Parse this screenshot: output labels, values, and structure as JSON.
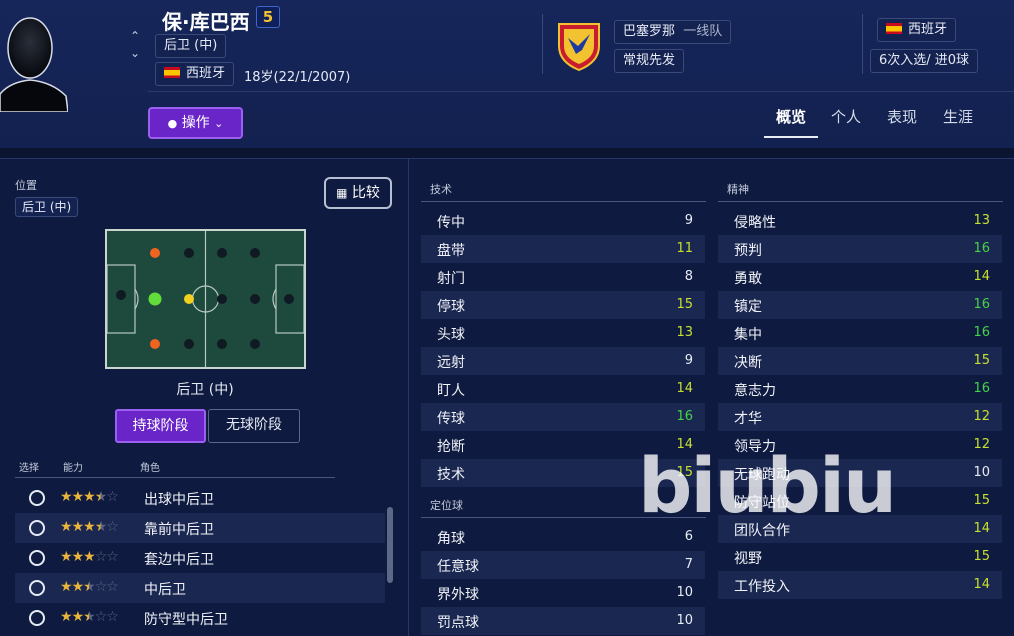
{
  "header": {
    "player_name": "保·库巴西",
    "shirt_number": "5",
    "position": "后卫 (中)",
    "nationality": "西班牙",
    "age": "18岁(22/1/2007)",
    "club": "巴塞罗那",
    "squad": "一线队",
    "role_status": "常规先发",
    "intl_nation": "西班牙",
    "intl_record": "6次入选/ 进0球",
    "action_label": "操作",
    "tabs": [
      "概览",
      "个人",
      "表现",
      "生涯"
    ],
    "active_tab": "概览"
  },
  "left": {
    "position_label": "位置",
    "position_value": "后卫 (中)",
    "compare_label": "比较",
    "pitch_caption": "后卫 (中)",
    "phase_in": "持球阶段",
    "phase_out": "无球阶段",
    "col_select": "选择",
    "col_ability": "能力",
    "col_role": "角色",
    "roles": [
      {
        "name": "出球中后卫",
        "stars": 3.5
      },
      {
        "name": "靠前中后卫",
        "stars": 3.5
      },
      {
        "name": "套边中后卫",
        "stars": 3
      },
      {
        "name": "中后卫",
        "stars": 2.5
      },
      {
        "name": "防守型中后卫",
        "stars": 2.5
      }
    ]
  },
  "technical": {
    "title": "技术",
    "items": [
      {
        "name": "传中",
        "value": "9",
        "color": "#e8ecf5"
      },
      {
        "name": "盘带",
        "value": "11",
        "color": "#c6e030"
      },
      {
        "name": "射门",
        "value": "8",
        "color": "#e8ecf5"
      },
      {
        "name": "停球",
        "value": "15",
        "color": "#c6e030"
      },
      {
        "name": "头球",
        "value": "13",
        "color": "#c6e030"
      },
      {
        "name": "远射",
        "value": "9",
        "color": "#e8ecf5"
      },
      {
        "name": "盯人",
        "value": "14",
        "color": "#c6e030"
      },
      {
        "name": "传球",
        "value": "16",
        "color": "#44d24a"
      },
      {
        "name": "抢断",
        "value": "14",
        "color": "#c6e030"
      },
      {
        "name": "技术",
        "value": "15",
        "color": "#c6e030"
      }
    ]
  },
  "set_pieces": {
    "title": "定位球",
    "items": [
      {
        "name": "角球",
        "value": "6",
        "color": "#e8ecf5"
      },
      {
        "name": "任意球",
        "value": "7",
        "color": "#e8ecf5"
      },
      {
        "name": "界外球",
        "value": "10",
        "color": "#e8ecf5"
      },
      {
        "name": "罚点球",
        "value": "10",
        "color": "#e8ecf5"
      }
    ]
  },
  "mental": {
    "title": "精神",
    "items": [
      {
        "name": "侵略性",
        "value": "13",
        "color": "#c6e030"
      },
      {
        "name": "预判",
        "value": "16",
        "color": "#44d24a"
      },
      {
        "name": "勇敢",
        "value": "14",
        "color": "#c6e030"
      },
      {
        "name": "镇定",
        "value": "16",
        "color": "#44d24a"
      },
      {
        "name": "集中",
        "value": "16",
        "color": "#44d24a"
      },
      {
        "name": "决断",
        "value": "15",
        "color": "#c6e030"
      },
      {
        "name": "意志力",
        "value": "16",
        "color": "#44d24a"
      },
      {
        "name": "才华",
        "value": "12",
        "color": "#c6e030"
      },
      {
        "name": "领导力",
        "value": "12",
        "color": "#c6e030"
      },
      {
        "name": "无球跑动",
        "value": "10",
        "color": "#e8ecf5"
      },
      {
        "name": "防守站位",
        "value": "15",
        "color": "#c6e030"
      },
      {
        "name": "团队合作",
        "value": "14",
        "color": "#c6e030"
      },
      {
        "name": "视野",
        "value": "15",
        "color": "#c6e030"
      },
      {
        "name": "工作投入",
        "value": "14",
        "color": "#c6e030"
      }
    ]
  },
  "watermark": "biubiu",
  "colors": {
    "accent_purple": "#6a25c9",
    "attr_high": "#44d24a",
    "attr_mid": "#c6e030"
  }
}
